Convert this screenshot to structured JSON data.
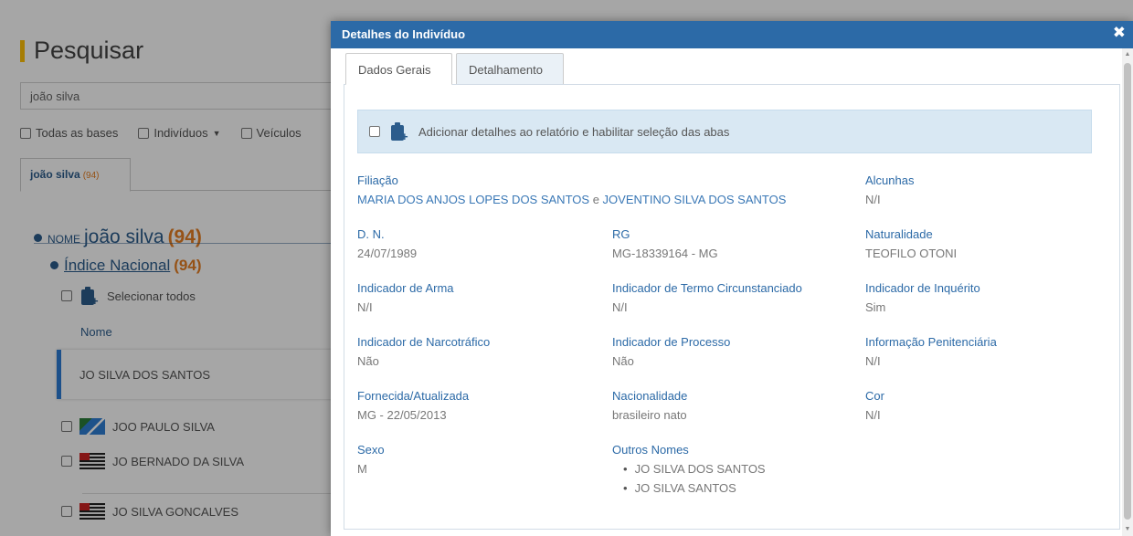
{
  "background": {
    "title": "Pesquisar",
    "search_value": "joão silva",
    "filters": [
      "Todas as bases",
      "Indivíduos",
      "Veículos"
    ],
    "result_tab": {
      "label": "joão silva",
      "count": "(94)"
    },
    "tree": {
      "nome_label": "NOME",
      "nome_value": "joão silva",
      "nome_count": "(94)",
      "indice_label": "Índice Nacional",
      "indice_count": "(94)",
      "select_all": "Selecionar todos",
      "column_header": "Nome",
      "rows": [
        "JO SILVA DOS SANTOS",
        "JOO PAULO SILVA",
        "JO BERNADO DA SILVA",
        "JO SILVA GONCALVES"
      ]
    }
  },
  "modal": {
    "title": "Detalhes do Indivíduo",
    "tabs": [
      "Dados Gerais",
      "Detalhamento"
    ],
    "notice": "Adicionar detalhes ao relatório e habilitar seleção das abas",
    "filiacao": {
      "label": "Filiação",
      "mother": "MARIA DOS ANJOS LOPES DOS SANTOS",
      "connector": "e",
      "father": "JOVENTINO SILVA DOS SANTOS"
    },
    "fields": {
      "alcunhas": {
        "label": "Alcunhas",
        "value": "N/I"
      },
      "dn": {
        "label": "D. N.",
        "value": "24/07/1989"
      },
      "rg": {
        "label": "RG",
        "value": "MG-18339164 - MG"
      },
      "naturalidade": {
        "label": "Naturalidade",
        "value": "TEOFILO OTONI"
      },
      "arma": {
        "label": "Indicador de Arma",
        "value": "N/I"
      },
      "termo": {
        "label": "Indicador de Termo Circunstanciado",
        "value": "N/I"
      },
      "inquerito": {
        "label": "Indicador de Inquérito",
        "value": "Sim"
      },
      "narco": {
        "label": "Indicador de Narcotráfico",
        "value": "Não"
      },
      "processo": {
        "label": "Indicador de Processo",
        "value": "Não"
      },
      "penitenciaria": {
        "label": "Informação Penitenciária",
        "value": "N/I"
      },
      "fornecida": {
        "label": "Fornecida/Atualizada",
        "value": "MG - 22/05/2013"
      },
      "nacionalidade": {
        "label": "Nacionalidade",
        "value": "brasileiro nato"
      },
      "cor": {
        "label": "Cor",
        "value": "N/I"
      },
      "sexo": {
        "label": "Sexo",
        "value": "M"
      }
    },
    "outros_nomes": {
      "label": "Outros Nomes",
      "items": [
        "JO SILVA DOS SANTOS",
        "JO SILVA SANTOS"
      ]
    }
  },
  "colors": {
    "header_blue": "#2c6aa7",
    "accent_orange": "#e67e22",
    "notice_bg": "#d9e8f3",
    "title_bar_yellow": "#ffc107"
  }
}
